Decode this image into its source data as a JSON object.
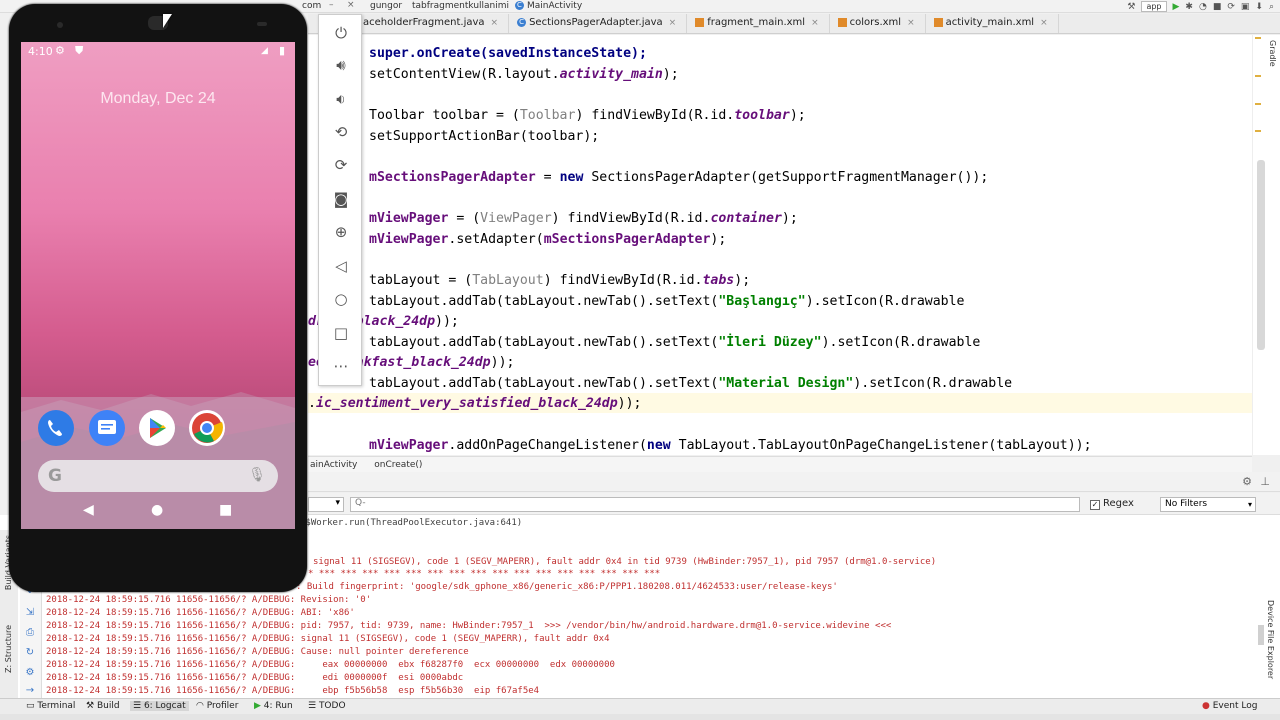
{
  "nav": {
    "crumbs": [
      "com",
      "gungor",
      "tabfragmentkullanimi",
      "MainActivity"
    ],
    "run_config": "app"
  },
  "tabs": [
    {
      "label": "aceholderFragment.java",
      "icon": "class-icon"
    },
    {
      "label": "SectionsPagerAdapter.java",
      "icon": "class-icon"
    },
    {
      "label": "fragment_main.xml",
      "icon": "xml-icon"
    },
    {
      "label": "colors.xml",
      "icon": "xml-icon"
    },
    {
      "label": "activity_main.xml",
      "icon": "xml-icon"
    }
  ],
  "editor_breadcrumb": [
    "ainActivity",
    "onCreate()"
  ],
  "logcat": {
    "device_select": "",
    "search_placeholder": "Q-",
    "regex_label": "Regex",
    "regex_checked": true,
    "filter": "No Filters",
    "lines": [
      "r$Worker.run(ThreadPoolExecutor.java:641)",
      "signal 11 (SIGSEGV), code 1 (SEGV_MAPERR), fault addr 0x4 in tid 9739 (HwBinder:7957_1), pid 7957 (drm@1.0-service)",
      "* *** *** *** *** *** *** *** *** *** *** *** *** *** *** *** ***",
      ": Build fingerprint: 'google/sdk_gphone_x86/generic_x86:P/PPP1.180208.011/4624533:user/release-keys'",
      "2018-12-24 18:59:15.716 11656-11656/? A/DEBUG: Revision: '0'",
      "2018-12-24 18:59:15.716 11656-11656/? A/DEBUG: ABI: 'x86'",
      "2018-12-24 18:59:15.716 11656-11656/? A/DEBUG: pid: 7957, tid: 9739, name: HwBinder:7957_1  >>> /vendor/bin/hw/android.hardware.drm@1.0-service.widevine <<<",
      "2018-12-24 18:59:15.716 11656-11656/? A/DEBUG: signal 11 (SIGSEGV), code 1 (SEGV_MAPERR), fault addr 0x4",
      "2018-12-24 18:59:15.716 11656-11656/? A/DEBUG: Cause: null pointer dereference",
      "2018-12-24 18:59:15.716 11656-11656/? A/DEBUG:     eax 00000000  ebx f68287f0  ecx 00000000  edx 00000000",
      "2018-12-24 18:59:15.716 11656-11656/? A/DEBUG:     edi 0000000f  esi 0000abdc",
      "2018-12-24 18:59:15.716 11656-11656/? A/DEBUG:     ebp f5b56b58  esp f5b56b30  eip f67af5e4"
    ]
  },
  "bottom_tabs": [
    "Terminal",
    "Build",
    "6: Logcat",
    "Profiler",
    "4: Run",
    "TODO"
  ],
  "event_log": "Event Log",
  "side_labels": {
    "left_structure": "Z: Structure",
    "left_build": "Build Variants",
    "right_explorer": "Device File Explorer",
    "right_gradle": "Gradle"
  },
  "phone": {
    "time": "4:10",
    "date": "Monday, Dec 24",
    "search_glyph": "G",
    "dock_apps": [
      "phone-icon",
      "messages-icon",
      "play-store-icon",
      "chrome-icon"
    ]
  },
  "emulator_controls": [
    "power-icon",
    "volume-up-icon",
    "volume-down-icon",
    "rotate-left-icon",
    "rotate-right-icon",
    "camera-icon",
    "zoom-icon",
    "back-icon",
    "home-icon",
    "overview-icon",
    "more-icon"
  ],
  "code": {
    "l1": "super.onCreate(savedInstanceState);",
    "l2_a": "setContentView(R.layout.",
    "l2_b": "activity_main",
    "l2_c": ");",
    "l3_a": "Toolbar toolbar = (",
    "l3_b": "Toolbar",
    "l3_c": ") findViewById(R.id.",
    "l3_d": "toolbar",
    "l3_e": ");",
    "l4": "setSupportActionBar(toolbar);",
    "l5_a": "mSectionsPagerAdapter",
    "l5_b": " = ",
    "l5_c": "new",
    "l5_d": " SectionsPagerAdapter(getSupportFragmentManager());",
    "l6_a": "mViewPager",
    "l6_b": " = (",
    "l6_c": "ViewPager",
    "l6_d": ") findViewById(R.id.",
    "l6_e": "container",
    "l6_f": ");",
    "l7_a": "mViewPager",
    "l7_b": ".setAdapter(",
    "l7_c": "mSectionsPagerAdapter",
    "l7_d": ");",
    "l8_a": "tabLayout = (",
    "l8_b": "TabLayout",
    "l8_c": ") findViewById(R.id.",
    "l8_d": "tabs",
    "l8_e": ");",
    "l9_a": "tabLayout.addTab(tabLayout.newTab().setText(",
    "l9_b": "\"Başlangıç\"",
    "l9_c": ").setIcon(R.drawable",
    "l10_a": "droid_black_24dp",
    "l10_b": "));",
    "l11_a": "tabLayout.addTab(tabLayout.newTab().setText(",
    "l11_b": "\"İleri Düzey\"",
    "l11_c": ").setIcon(R.drawable",
    "l12_a": "ee_breakfast_black_24dp",
    "l12_b": "));",
    "l13_a": "tabLayout.addTab(tabLayout.newTab().setText(",
    "l13_b": "\"Material Design\"",
    "l13_c": ").setIcon(R.drawable",
    "l14_a": ".",
    "l14_b": "ic_sentiment_very_satisfied_black_24dp",
    "l14_c": "));",
    "l15_a": "mViewPager",
    "l15_b": ".addOnPageChangeListener(",
    "l15_c": "new",
    "l15_d": " TabLayout.TabLayoutOnPageChangeListener(tabLayout));"
  }
}
